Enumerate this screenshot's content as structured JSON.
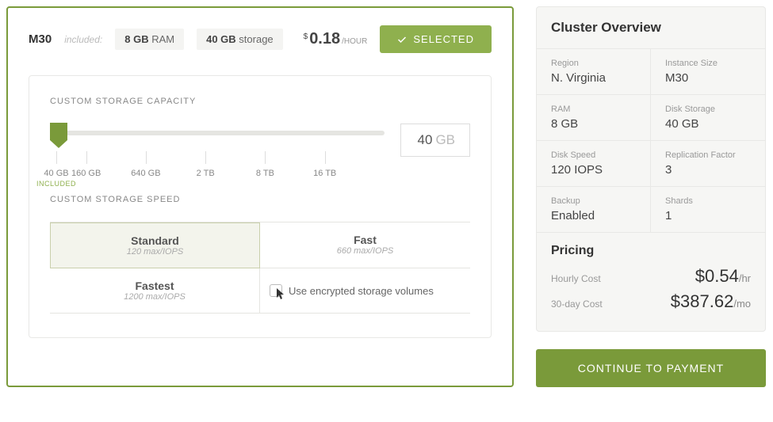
{
  "tier": {
    "name": "M30",
    "included_label": "included:",
    "ram_value": "8 GB",
    "ram_label": "RAM",
    "storage_value": "40 GB",
    "storage_label": "storage",
    "price_amount": "0.18",
    "price_unit": "/HOUR",
    "selected_label": "SELECTED"
  },
  "storage_capacity": {
    "title": "CUSTOM STORAGE CAPACITY",
    "current_value": "40",
    "current_unit": "GB",
    "ticks": [
      {
        "label": "40 GB",
        "sub": "INCLUDED"
      },
      {
        "label": "160 GB"
      },
      {
        "label": "640 GB"
      },
      {
        "label": "2 TB"
      },
      {
        "label": "8 TB"
      },
      {
        "label": "16 TB"
      }
    ]
  },
  "storage_speed": {
    "title": "CUSTOM STORAGE SPEED",
    "options": [
      {
        "name": "Standard",
        "sub": "120 max/IOPS",
        "selected": true
      },
      {
        "name": "Fast",
        "sub": "660 max/IOPS",
        "selected": false
      },
      {
        "name": "Fastest",
        "sub": "1200 max/IOPS",
        "selected": false
      }
    ],
    "encrypt_label": "Use encrypted storage volumes"
  },
  "overview": {
    "title": "Cluster Overview",
    "cells": [
      {
        "label": "Region",
        "value": "N. Virginia"
      },
      {
        "label": "Instance Size",
        "value": "M30"
      },
      {
        "label": "RAM",
        "value": "8 GB"
      },
      {
        "label": "Disk Storage",
        "value": "40 GB"
      },
      {
        "label": "Disk Speed",
        "value": "120 IOPS"
      },
      {
        "label": "Replication Factor",
        "value": "3"
      },
      {
        "label": "Backup",
        "value": "Enabled"
      },
      {
        "label": "Shards",
        "value": "1"
      }
    ],
    "pricing_title": "Pricing",
    "hourly_label": "Hourly Cost",
    "hourly_value": "$0.54",
    "hourly_unit": "/hr",
    "monthly_label": "30-day Cost",
    "monthly_value": "$387.62",
    "monthly_unit": "/mo"
  },
  "continue_label": "CONTINUE TO PAYMENT"
}
